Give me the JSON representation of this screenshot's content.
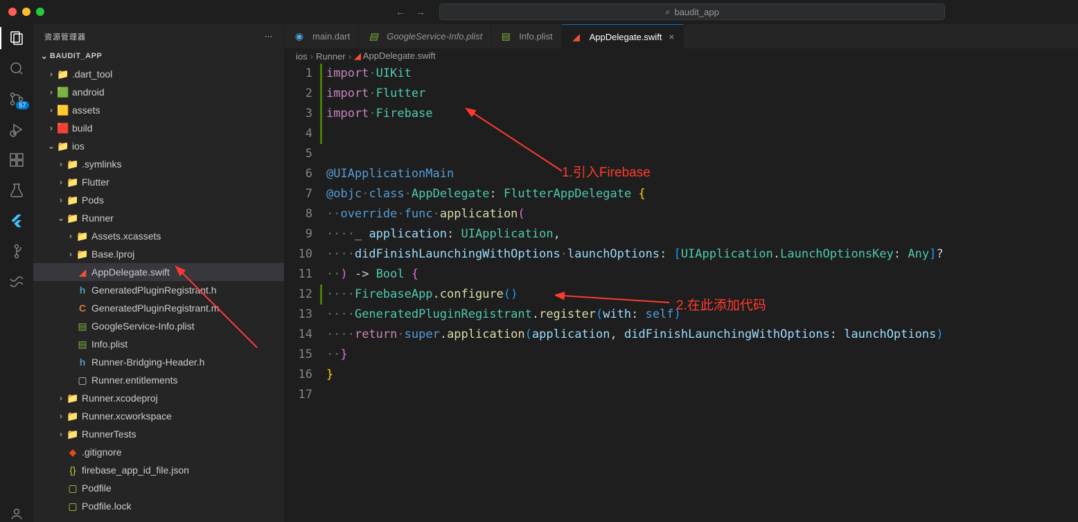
{
  "titlebar": {
    "search_text": "baudit_app"
  },
  "sidebar": {
    "header": "资源管理器",
    "project": "BAUDIT_APP"
  },
  "tree": [
    {
      "indent": 1,
      "chevron": "right",
      "icon": "folder",
      "label": ".dart_tool"
    },
    {
      "indent": 1,
      "chevron": "right",
      "icon": "folder-green",
      "label": "android"
    },
    {
      "indent": 1,
      "chevron": "right",
      "icon": "folder-yellow",
      "label": "assets"
    },
    {
      "indent": 1,
      "chevron": "right",
      "icon": "folder-red",
      "label": "build"
    },
    {
      "indent": 1,
      "chevron": "down",
      "icon": "folder-teal",
      "label": "ios"
    },
    {
      "indent": 2,
      "chevron": "right",
      "icon": "folder",
      "label": ".symlinks"
    },
    {
      "indent": 2,
      "chevron": "right",
      "icon": "folder",
      "label": "Flutter"
    },
    {
      "indent": 2,
      "chevron": "right",
      "icon": "folder",
      "label": "Pods"
    },
    {
      "indent": 2,
      "chevron": "down",
      "icon": "folder",
      "label": "Runner"
    },
    {
      "indent": 3,
      "chevron": "right",
      "icon": "folder",
      "label": "Assets.xcassets"
    },
    {
      "indent": 3,
      "chevron": "right",
      "icon": "folder",
      "label": "Base.lproj"
    },
    {
      "indent": 3,
      "chevron": "",
      "icon": "swift",
      "label": "AppDelegate.swift",
      "selected": true
    },
    {
      "indent": 3,
      "chevron": "",
      "icon": "h",
      "label": "GeneratedPluginRegistrant.h"
    },
    {
      "indent": 3,
      "chevron": "",
      "icon": "m",
      "label": "GeneratedPluginRegistrant.m"
    },
    {
      "indent": 3,
      "chevron": "",
      "icon": "plist",
      "label": "GoogleService-Info.plist"
    },
    {
      "indent": 3,
      "chevron": "",
      "icon": "plist",
      "label": "Info.plist"
    },
    {
      "indent": 3,
      "chevron": "",
      "icon": "h",
      "label": "Runner-Bridging-Header.h"
    },
    {
      "indent": 3,
      "chevron": "",
      "icon": "file",
      "label": "Runner.entitlements"
    },
    {
      "indent": 2,
      "chevron": "right",
      "icon": "folder",
      "label": "Runner.xcodeproj"
    },
    {
      "indent": 2,
      "chevron": "right",
      "icon": "folder",
      "label": "Runner.xcworkspace"
    },
    {
      "indent": 2,
      "chevron": "right",
      "icon": "folder",
      "label": "RunnerTests"
    },
    {
      "indent": 2,
      "chevron": "",
      "icon": "git",
      "label": ".gitignore"
    },
    {
      "indent": 2,
      "chevron": "",
      "icon": "json",
      "label": "firebase_app_id_file.json"
    },
    {
      "indent": 2,
      "chevron": "",
      "icon": "file-yellow",
      "label": "Podfile"
    },
    {
      "indent": 2,
      "chevron": "",
      "icon": "file-yellow",
      "label": "Podfile.lock"
    }
  ],
  "tabs": [
    {
      "icon": "dart",
      "label": "main.dart",
      "active": false
    },
    {
      "icon": "plist",
      "label": "GoogleService-Info.plist",
      "active": false,
      "italic": true
    },
    {
      "icon": "plist",
      "label": "Info.plist",
      "active": false
    },
    {
      "icon": "swift",
      "label": "AppDelegate.swift",
      "active": true,
      "close": true
    }
  ],
  "breadcrumbs": [
    "ios",
    "Runner",
    "AppDelegate.swift"
  ],
  "scm_badge": "57",
  "gutter_lines": [
    "1",
    "2",
    "3",
    "4",
    "5",
    "6",
    "7",
    "8",
    "9",
    "10",
    "11",
    "12",
    "13",
    "14",
    "15",
    "16",
    "17"
  ],
  "annotations": {
    "a1": "1.引入Firebase",
    "a2": "2.在此添加代码"
  },
  "code": {
    "import": "import",
    "uikit": "UIKit",
    "flutter": "Flutter",
    "firebase": "Firebase",
    "uiappmain": "@UIApplicationMain",
    "objc": "@objc",
    "class": "class",
    "appdelegate": "AppDelegate",
    "flutterappdelegate": "FlutterAppDelegate",
    "override": "override",
    "func": "func",
    "application": "application",
    "uiapplication": "UIApplication",
    "didfinish": "didFinishLaunchingWithOptions",
    "launchoptions_param": "launchOptions",
    "launchoptionskey": "LaunchOptionsKey",
    "any": "Any",
    "bool": "Bool",
    "firebaseapp": "FirebaseApp",
    "configure": "configure",
    "genreg": "GeneratedPluginRegistrant",
    "register": "register",
    "with": "with",
    "self": "self",
    "return": "return",
    "super": "super",
    "application2": "application",
    "launchoptions_arg": "launchOptions"
  }
}
